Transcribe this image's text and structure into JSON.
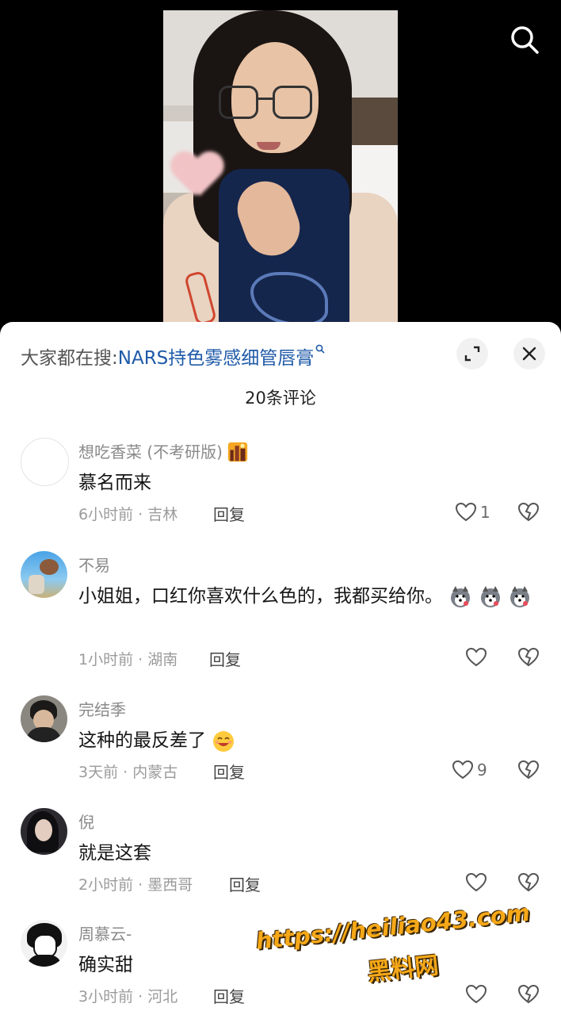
{
  "video": {
    "search_icon": "search-icon"
  },
  "sheet": {
    "trend_label": "大家都在搜:",
    "trend_keyword": "NARS持色雾感细管唇膏",
    "comment_count": "20条评论",
    "expand_icon": "expand-icon",
    "close_icon": "close-icon"
  },
  "comments": [
    {
      "username": "想吃香菜 (不考研版)",
      "text": "慕名而来",
      "meta": "6小时前 · 吉林",
      "reply": "回复",
      "likes": "1"
    },
    {
      "username": "不易",
      "text": "小姐姐，口红你喜欢什么色的，我都买给你。",
      "meta": "1小时前 · 湖南",
      "reply": "回复",
      "likes": ""
    },
    {
      "username": "完结季",
      "text": "这种的最反差了",
      "meta": "3天前 · 内蒙古",
      "reply": "回复",
      "likes": "9"
    },
    {
      "username": "倪",
      "text": "就是这套",
      "meta": "2小时前 · 墨西哥",
      "reply": "回复",
      "likes": ""
    },
    {
      "username": "周慕云-",
      "text": "确实甜",
      "meta": "3小时前 · 河北",
      "reply": "回复",
      "likes": ""
    }
  ],
  "watermark": {
    "line1": "https://heiliao43.com",
    "line2": "黑料网"
  },
  "colors": {
    "keyword": "#1f5aa8",
    "watermark": "#f6a818"
  }
}
